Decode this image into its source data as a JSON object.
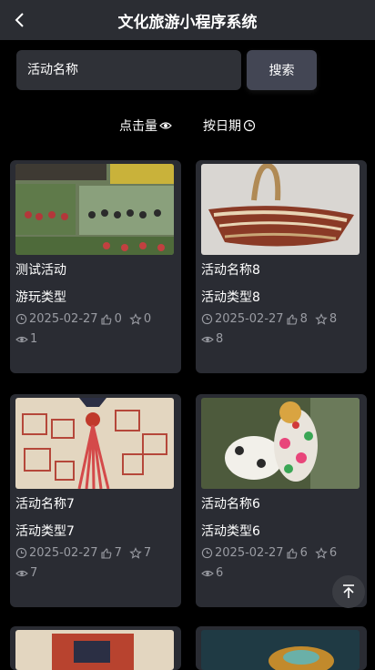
{
  "header": {
    "title": "文化旅游小程序系统"
  },
  "search": {
    "placeholder": "活动名称",
    "button_label": "搜索"
  },
  "sort": {
    "clicks_label": "点击量",
    "date_label": "按日期"
  },
  "cards": [
    {
      "name": "测试活动",
      "type": "游玩类型",
      "date": "2025-02-27",
      "likes": "0",
      "favorites": "0",
      "views": "1"
    },
    {
      "name": "活动名称8",
      "type": "活动类型8",
      "date": "2025-02-27",
      "likes": "8",
      "favorites": "8",
      "views": "8"
    },
    {
      "name": "活动名称7",
      "type": "活动类型7",
      "date": "2025-02-27",
      "likes": "7",
      "favorites": "7",
      "views": "7"
    },
    {
      "name": "活动名称6",
      "type": "活动类型6",
      "date": "2025-02-27",
      "likes": "6",
      "favorites": "6",
      "views": "6"
    }
  ],
  "icons": {
    "back": "chevron-left-icon",
    "eye": "eye-icon",
    "clock": "clock-icon",
    "thumb": "thumb-up-icon",
    "star": "star-icon",
    "top": "arrow-up-to-top-icon"
  }
}
